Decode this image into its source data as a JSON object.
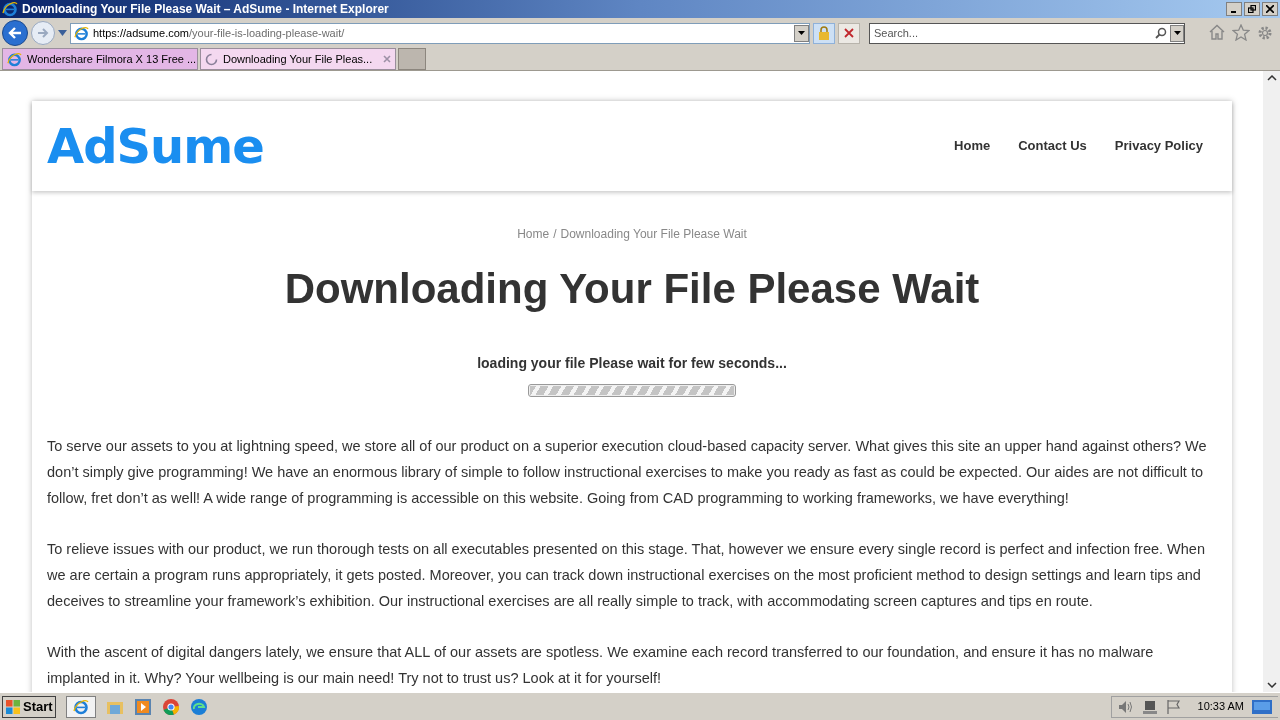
{
  "window": {
    "title": "Downloading Your File Please Wait – AdSume - Internet Explorer"
  },
  "address": {
    "host": "https://adsume.com",
    "path": "/your-file-is-loading-please-wait/"
  },
  "search": {
    "placeholder": "Search..."
  },
  "tabs": [
    {
      "label": "Wondershare Filmora X 13 Free ...",
      "selected": false,
      "loading": false
    },
    {
      "label": "Downloading Your File Pleas...",
      "selected": true,
      "loading": true
    }
  ],
  "site": {
    "logo": "AdSume",
    "nav": [
      "Home",
      "Contact Us",
      "Privacy Policy"
    ]
  },
  "breadcrumb": {
    "home": "Home",
    "separator": "/",
    "current": "Downloading Your File Please Wait"
  },
  "heading": "Downloading Your File Please Wait",
  "loading": {
    "text": "loading your file Please wait for few seconds...",
    "level": 1
  },
  "paragraphs": [
    "To serve our assets to you at lightning speed, we store all of our product on a superior execution cloud-based capacity server. What gives this site an upper hand against others? We don’t simply give programming! We have an enormous library of simple to follow instructional exercises to make you ready as fast as could be expected. Our aides are not difficult to follow, fret don’t as well! A wide range of programming is accessible on this website. Going from CAD programming to working frameworks, we have everything!",
    "To relieve issues with our product, we run thorough tests on all executables presented on this stage. That, however we ensure every single record is perfect and infection free. When we are certain a program runs appropriately, it gets posted. Moreover, you can track down instructional exercises on the most proficient method to design settings and learn tips and deceives to streamline your framework’s exhibition. Our instructional exercises are all really simple to track, with accommodating screen captures and tips en route.",
    "With the ascent of digital dangers lately, we ensure that ALL of our assets are spotless. We examine each record transferred to our foundation, and ensure it has no malware implanted in it. Why? Your wellbeing is our main need! Try not to trust us? Look at it for yourself!"
  ],
  "taskbar": {
    "start": "Start",
    "clock": "10:33 AM"
  }
}
